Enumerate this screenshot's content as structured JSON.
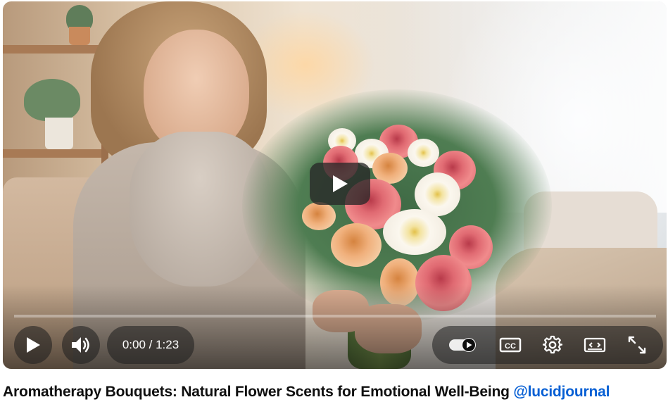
{
  "player": {
    "time_current": "0:00",
    "time_separator": " / ",
    "time_total": "1:23",
    "progress": 0,
    "accent_color": "#ff0000",
    "icons": {
      "big_play": "play-icon",
      "play": "play-icon",
      "volume": "volume-icon",
      "autoplay": "autoplay-toggle-icon",
      "captions": "captions-icon",
      "settings": "gear-icon",
      "theater": "theater-mode-icon",
      "fullscreen": "fullscreen-icon"
    },
    "captions_label": "CC"
  },
  "video": {
    "title": "Aromatherapy Bouquets: Natural Flower Scents for Emotional Well-Being",
    "channel": "@lucidjournal"
  }
}
